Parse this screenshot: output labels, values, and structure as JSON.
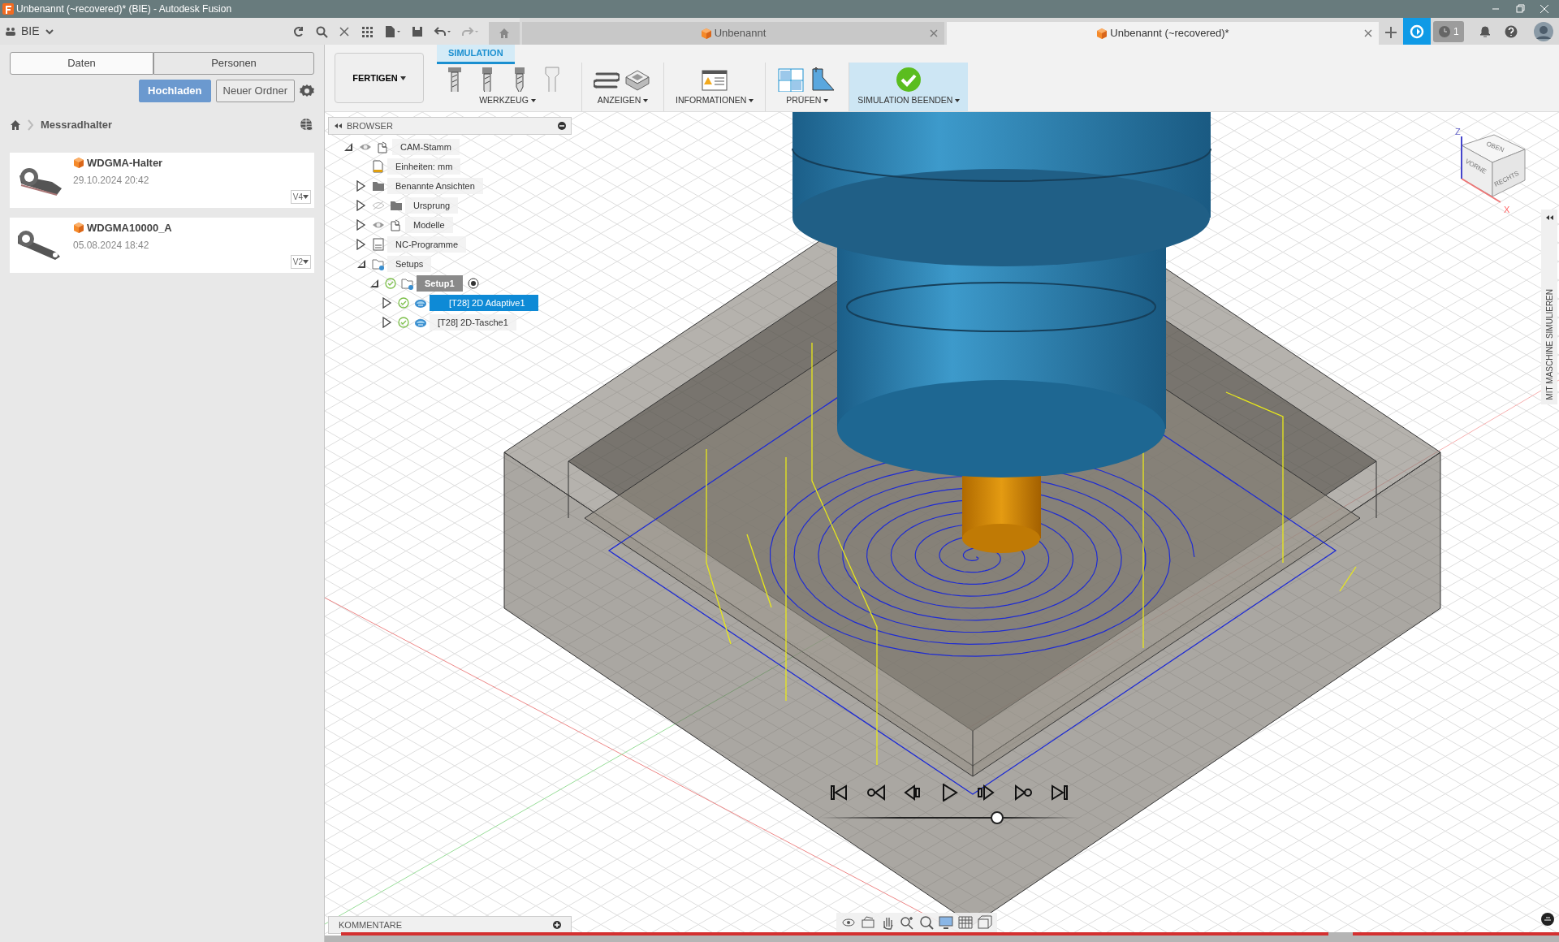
{
  "window": {
    "title": "Unbenannt (~recovered)* (BIE) - Autodesk Fusion"
  },
  "team": {
    "name": "BIE"
  },
  "document_tabs": [
    {
      "label": "Unbenannt",
      "selected": false
    },
    {
      "label": "Unbenannt (~recovered)*",
      "selected": true
    }
  ],
  "jobs": {
    "count": "1"
  },
  "data_panel": {
    "tabs": [
      {
        "label": "Daten",
        "selected": true
      },
      {
        "label": "Personen",
        "selected": false
      }
    ],
    "buttons": [
      {
        "label": "Hochladen",
        "kind": "primary"
      },
      {
        "label": "Neuer Ordner",
        "kind": "secondary"
      }
    ],
    "breadcrumb": "Messradhalter",
    "files": [
      {
        "name": "WDGMA-Halter",
        "date": "29.10.2024 20:42",
        "version": "V4"
      },
      {
        "name": "WDGMA10000_A",
        "date": "05.08.2024 18:42",
        "version": "V2"
      }
    ]
  },
  "ribbon": {
    "workspace": "FERTIGEN",
    "tab": "SIMULATION",
    "groups": [
      {
        "label": "WERKZEUG",
        "kind": "tools",
        "highlighted": false
      },
      {
        "label": "ANZEIGEN",
        "kind": "display",
        "highlighted": false
      },
      {
        "label": "INFORMATIONEN",
        "kind": "info",
        "highlighted": false
      },
      {
        "label": "PRÜFEN",
        "kind": "inspect",
        "highlighted": false
      },
      {
        "label": "SIMULATION BEENDEN",
        "kind": "finish",
        "highlighted": true
      }
    ]
  },
  "browser": {
    "title": "BROWSER",
    "tree": [
      {
        "label": "CAM-Stamm",
        "kind": "root",
        "visible": true,
        "expanded": true,
        "selected": false,
        "active": false,
        "children": [
          {
            "label": "Einheiten: mm",
            "kind": "units",
            "selected": false,
            "active": false
          },
          {
            "label": "Benannte Ansichten",
            "kind": "folder",
            "expanded": false,
            "selected": false,
            "active": false
          },
          {
            "label": "Ursprung",
            "kind": "folder",
            "visible": false,
            "expanded": false,
            "selected": false,
            "active": false
          },
          {
            "label": "Modelle",
            "kind": "models",
            "visible": true,
            "expanded": false,
            "selected": false,
            "active": false
          },
          {
            "label": "NC-Programme",
            "kind": "nc",
            "expanded": false,
            "selected": false,
            "active": false
          },
          {
            "label": "Setups",
            "kind": "setups",
            "expanded": true,
            "selected": false,
            "active": false,
            "children": [
              {
                "label": "Setup1",
                "kind": "setup",
                "expanded": true,
                "selected": false,
                "active": true,
                "children": [
                  {
                    "label": "[T28] 2D Adaptive1",
                    "kind": "operation",
                    "expanded": false,
                    "selected": true,
                    "active": false
                  },
                  {
                    "label": "[T28] 2D-Tasche1",
                    "kind": "operation",
                    "expanded": false,
                    "selected": false,
                    "active": false
                  }
                ]
              }
            ]
          }
        ]
      }
    ]
  },
  "viewcube": {
    "faces": [
      "OBEN",
      "VORNE",
      "RECHTS"
    ],
    "axes": [
      "Z",
      "X"
    ]
  },
  "side_panel": {
    "label": "MIT MASCHINE SIMULIEREN"
  },
  "playback": {
    "level": 0.68
  },
  "comments": {
    "title": "KOMMENTARE"
  }
}
